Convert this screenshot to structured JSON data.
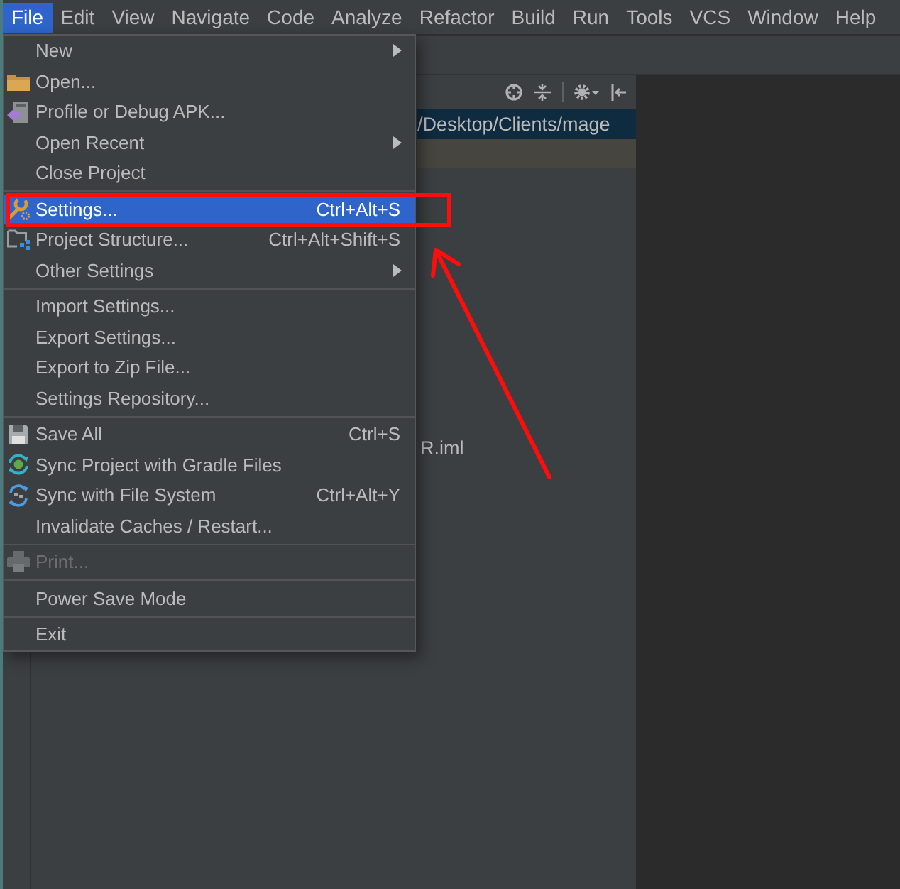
{
  "menu_bar": {
    "items": [
      {
        "label": "File",
        "selected": true
      },
      {
        "label": "Edit",
        "selected": false
      },
      {
        "label": "View",
        "selected": false
      },
      {
        "label": "Navigate",
        "selected": false
      },
      {
        "label": "Code",
        "selected": false
      },
      {
        "label": "Analyze",
        "selected": false
      },
      {
        "label": "Refactor",
        "selected": false
      },
      {
        "label": "Build",
        "selected": false
      },
      {
        "label": "Run",
        "selected": false
      },
      {
        "label": "Tools",
        "selected": false
      },
      {
        "label": "VCS",
        "selected": false
      },
      {
        "label": "Window",
        "selected": false
      },
      {
        "label": "Help",
        "selected": false
      }
    ]
  },
  "file_menu": {
    "items": [
      {
        "kind": "item",
        "label": "New",
        "submenu": true,
        "selected": false,
        "disabled": false
      },
      {
        "kind": "item",
        "label": "Open...",
        "submenu": false,
        "selected": false,
        "disabled": false
      },
      {
        "kind": "item",
        "label": "Profile or Debug APK...",
        "submenu": false,
        "selected": false,
        "disabled": false
      },
      {
        "kind": "item",
        "label": "Open Recent",
        "submenu": true,
        "selected": false,
        "disabled": false
      },
      {
        "kind": "item",
        "label": "Close Project",
        "submenu": false,
        "selected": false,
        "disabled": false
      },
      {
        "kind": "separator"
      },
      {
        "kind": "item",
        "label": "Settings...",
        "shortcut": "Ctrl+Alt+S",
        "submenu": false,
        "selected": true,
        "disabled": false
      },
      {
        "kind": "item",
        "label": "Project Structure...",
        "shortcut": "Ctrl+Alt+Shift+S",
        "submenu": false,
        "selected": false,
        "disabled": false
      },
      {
        "kind": "item",
        "label": "Other Settings",
        "submenu": true,
        "selected": false,
        "disabled": false
      },
      {
        "kind": "separator"
      },
      {
        "kind": "item",
        "label": "Import Settings...",
        "submenu": false,
        "selected": false,
        "disabled": false
      },
      {
        "kind": "item",
        "label": "Export Settings...",
        "submenu": false,
        "selected": false,
        "disabled": false
      },
      {
        "kind": "item",
        "label": "Export to Zip File...",
        "submenu": false,
        "selected": false,
        "disabled": false
      },
      {
        "kind": "item",
        "label": "Settings Repository...",
        "submenu": false,
        "selected": false,
        "disabled": false
      },
      {
        "kind": "separator"
      },
      {
        "kind": "item",
        "label": "Save All",
        "shortcut": "Ctrl+S",
        "submenu": false,
        "selected": false,
        "disabled": false
      },
      {
        "kind": "item",
        "label": "Sync Project with Gradle Files",
        "submenu": false,
        "selected": false,
        "disabled": false
      },
      {
        "kind": "item",
        "label": "Sync with File System",
        "shortcut": "Ctrl+Alt+Y",
        "submenu": false,
        "selected": false,
        "disabled": false
      },
      {
        "kind": "item",
        "label": "Invalidate Caches / Restart...",
        "submenu": false,
        "selected": false,
        "disabled": false
      },
      {
        "kind": "separator"
      },
      {
        "kind": "item",
        "label": "Print...",
        "submenu": false,
        "selected": false,
        "disabled": true
      },
      {
        "kind": "separator"
      },
      {
        "kind": "item",
        "label": "Power Save Mode",
        "submenu": false,
        "selected": false,
        "disabled": false
      },
      {
        "kind": "separator"
      },
      {
        "kind": "item",
        "label": "Exit",
        "submenu": false,
        "selected": false,
        "disabled": false
      }
    ]
  },
  "project_panel": {
    "path": "/Desktop/Clients/mage",
    "file": "R.iml"
  }
}
